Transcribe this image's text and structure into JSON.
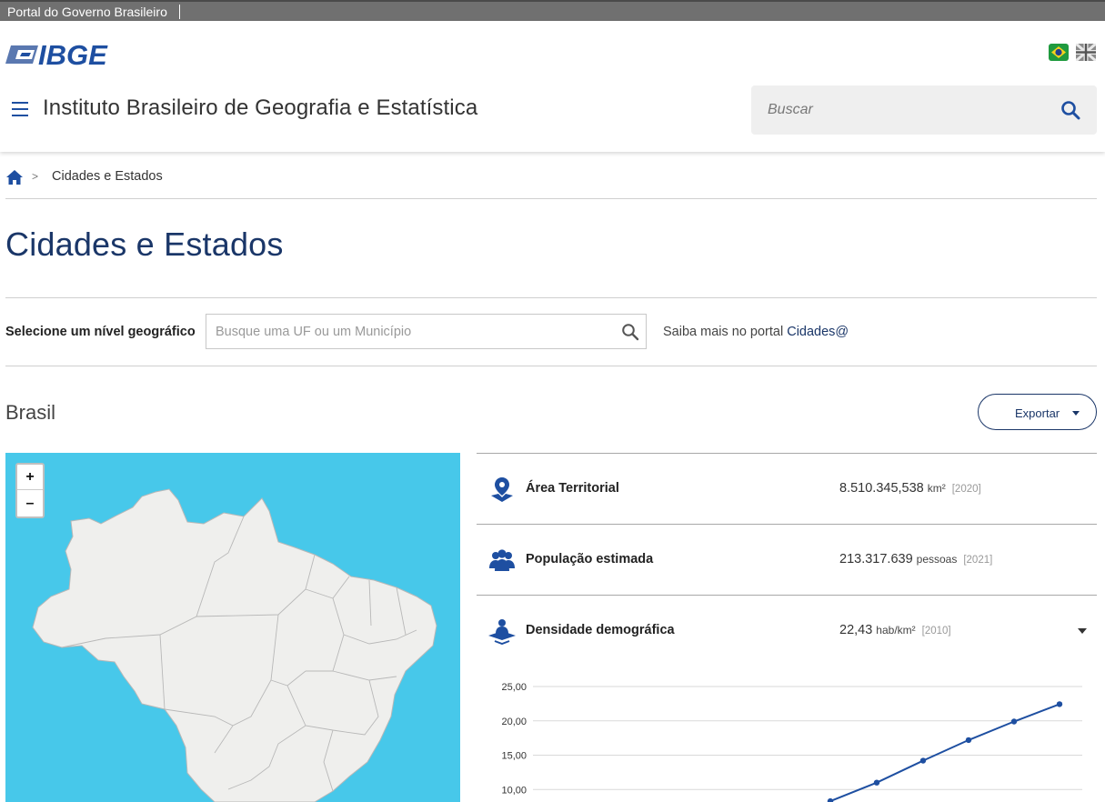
{
  "gov_bar": {
    "label": "Portal do Governo Brasileiro"
  },
  "header": {
    "logo_text": "IBGE",
    "title": "Instituto Brasileiro de Geografia e Estatística",
    "search_placeholder": "Buscar",
    "flags": [
      "flag-brazil-icon",
      "flag-uk-icon"
    ]
  },
  "breadcrumb": {
    "separator": ">",
    "current": "Cidades e Estados"
  },
  "page": {
    "title": "Cidades e Estados"
  },
  "geo_selector": {
    "label": "Selecione um nível geográfico",
    "placeholder": "Busque uma UF ou um Município",
    "saiba_prefix": "Saiba mais no portal ",
    "saiba_link": "Cidades@"
  },
  "location": {
    "name": "Brasil",
    "export_label": "Exportar"
  },
  "map": {
    "zoom_in": "+",
    "zoom_out": "–",
    "water_color": "#47c8ea",
    "land_color": "#efefed"
  },
  "indicators": [
    {
      "name": "Área Territorial",
      "value": "8.510.345,538",
      "unit": "km²",
      "year": "[2020]",
      "icon": "map-pin-icon"
    },
    {
      "name": "População estimada",
      "value": "213.317.639",
      "unit": "pessoas",
      "year": "[2021]",
      "icon": "people-icon"
    },
    {
      "name": "Densidade demográfica",
      "value": "22,43",
      "unit": "hab/km²",
      "year": "[2010]",
      "icon": "density-icon"
    }
  ],
  "colors": {
    "brand": "#1a3668",
    "accent": "#1e4fa1"
  },
  "chart_data": {
    "type": "line",
    "title": "",
    "ylim": [
      0,
      25
    ],
    "y_ticks": [
      "25,00",
      "20,00",
      "15,00",
      "10,00"
    ],
    "series": [
      {
        "values": [
          8.3,
          11.0,
          14.2,
          17.2,
          19.9,
          22.43
        ]
      }
    ]
  }
}
